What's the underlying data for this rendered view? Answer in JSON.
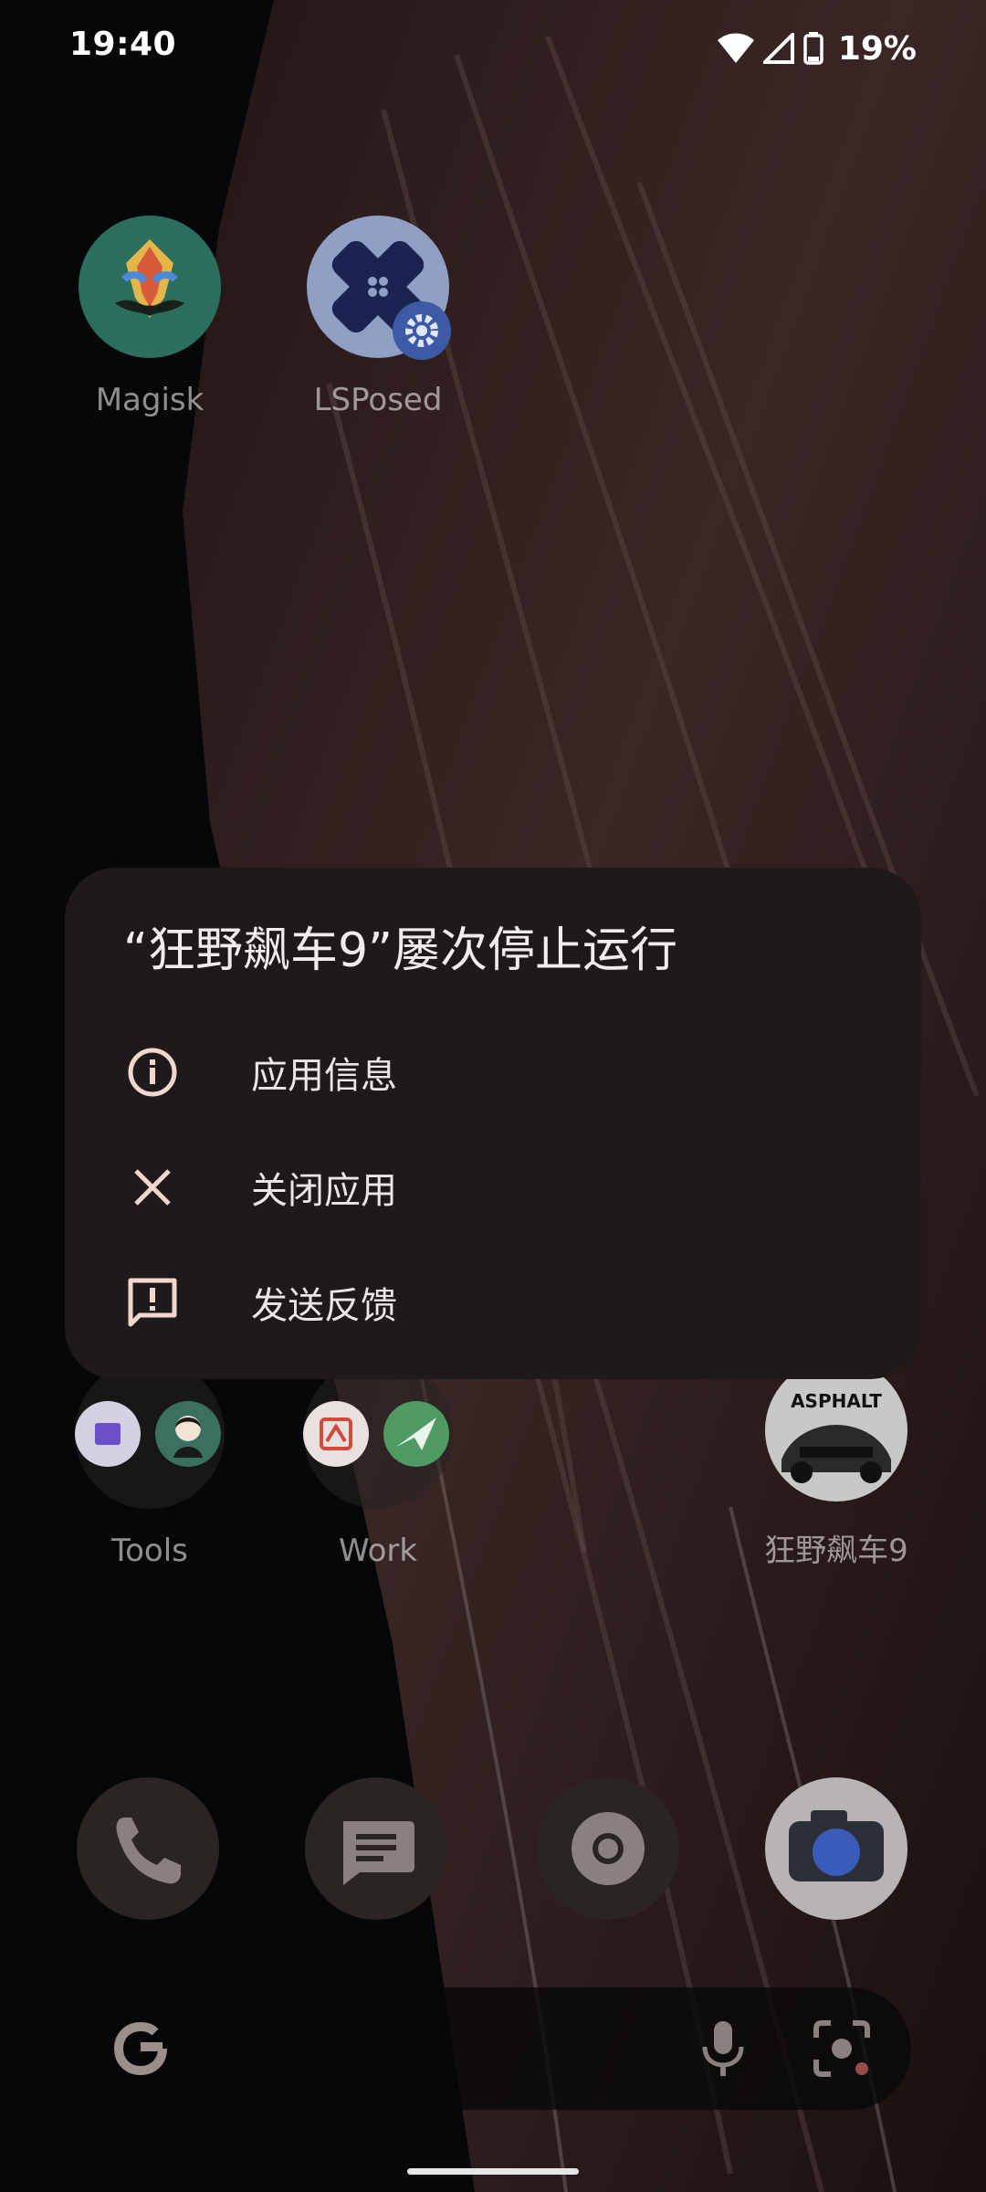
{
  "status_bar": {
    "time": "19:40",
    "battery_percent": "19%"
  },
  "home": {
    "apps_top": [
      {
        "name": "Magisk"
      },
      {
        "name": "LSPosed"
      }
    ],
    "folders": [
      {
        "name": "Tools"
      },
      {
        "name": "Work"
      }
    ],
    "game_app": {
      "name": "狂野飙车9",
      "logo_text": "ASPHALT"
    }
  },
  "dialog": {
    "title": "“狂野飙车9”屡次停止运行",
    "items": [
      {
        "label": "应用信息",
        "icon": "info-icon"
      },
      {
        "label": "关闭应用",
        "icon": "close-icon"
      },
      {
        "label": "发送反馈",
        "icon": "feedback-icon"
      }
    ]
  },
  "dock": {
    "apps": [
      "phone-icon",
      "messages-icon",
      "chrome-icon",
      "camera-icon"
    ]
  },
  "search_bar": {
    "logo": "google-g-icon",
    "mic": "mic-icon",
    "lens": "lens-icon"
  },
  "colors": {
    "dialog_bg": "#1e191a",
    "dialog_icon": "#f3d7cf",
    "wallpaper_rock": "#5a3b3a"
  }
}
